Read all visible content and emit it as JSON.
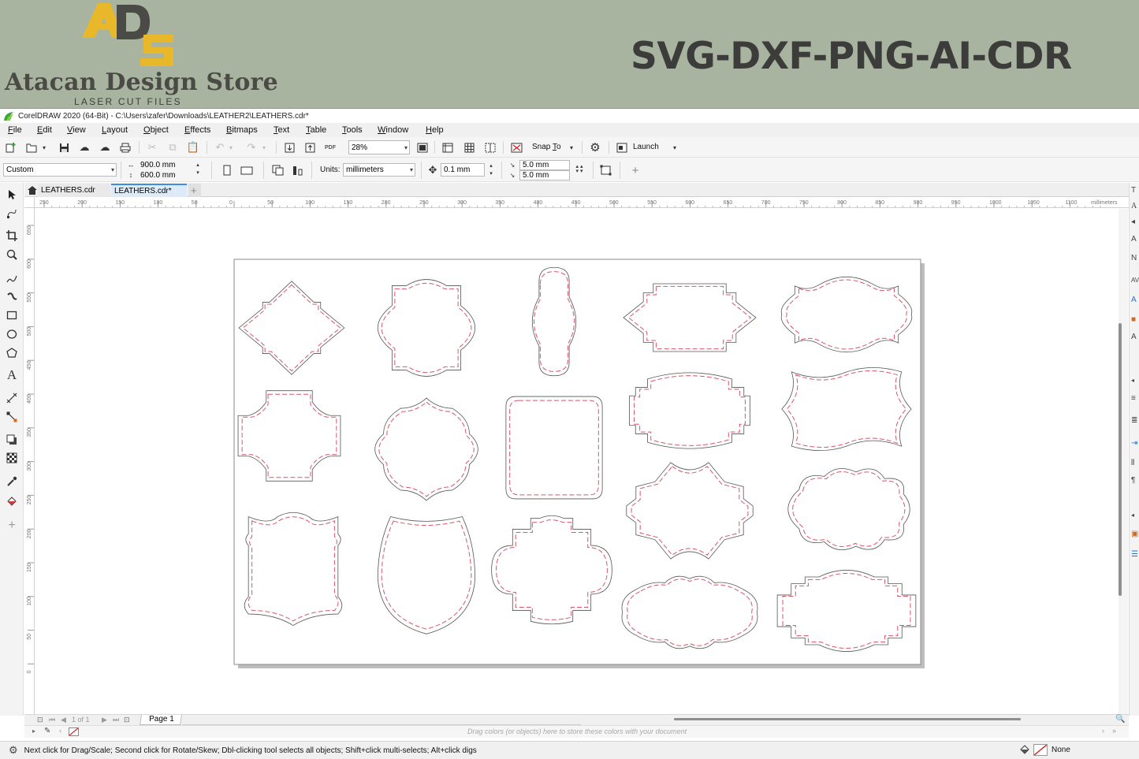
{
  "banner": {
    "logo_letters": "ADS",
    "store_name": "Atacan Design Store",
    "store_sub": "LASER CUT FILES",
    "formats": "SVG-DXF-PNG-AI-CDR",
    "bg_color": "#a8b3a0",
    "logo_color": "#e8b82a"
  },
  "window": {
    "title": "CorelDRAW 2020 (64-Bit) - C:\\Users\\zafer\\Downloads\\LEATHER2\\LEATHERS.cdr*"
  },
  "menu": {
    "items": [
      "File",
      "Edit",
      "View",
      "Layout",
      "Object",
      "Effects",
      "Bitmaps",
      "Text",
      "Table",
      "Tools",
      "Window",
      "Help"
    ]
  },
  "toolbar": {
    "zoom": "28%",
    "snap_label": "Snap To",
    "launch_label": "Launch",
    "pdf_label": "PDF"
  },
  "propbar": {
    "page_preset": "Custom",
    "width": "900.0 mm",
    "height": "600.0 mm",
    "units_label": "Units:",
    "units_value": "millimeters",
    "nudge": "0.1 mm",
    "dup_x": "5.0 mm",
    "dup_y": "5.0 mm"
  },
  "tabs": [
    {
      "label": "LEATHERS.cdr",
      "active": false
    },
    {
      "label": "LEATHERS.cdr*",
      "active": true
    }
  ],
  "ruler": {
    "h_labels": [
      "250",
      "200",
      "150",
      "100",
      "50",
      "0",
      "50",
      "100",
      "150",
      "200",
      "250",
      "300",
      "350",
      "400",
      "450",
      "500",
      "550",
      "600",
      "650",
      "700",
      "750",
      "800",
      "850",
      "900",
      "950",
      "1000",
      "1050",
      "1100"
    ],
    "units": "millimeters",
    "v_labels": [
      "650",
      "600",
      "550",
      "500",
      "450",
      "400",
      "350",
      "300",
      "250",
      "200",
      "150",
      "100",
      "50",
      "0"
    ]
  },
  "pagenav": {
    "counter": "1 of 1",
    "page_tab": "Page 1"
  },
  "palette": {
    "hint": "Drag colors (or objects) here to store these colors with your document"
  },
  "status": {
    "hint": "Next click for Drag/Scale; Second click for Rotate/Skew; Dbl-clicking tool selects all objects; Shift+click multi-selects; Alt+click digs",
    "fill": "None"
  },
  "colors": {
    "cut_line": "#3a3a3a",
    "stitch_line": "#d9556a"
  }
}
